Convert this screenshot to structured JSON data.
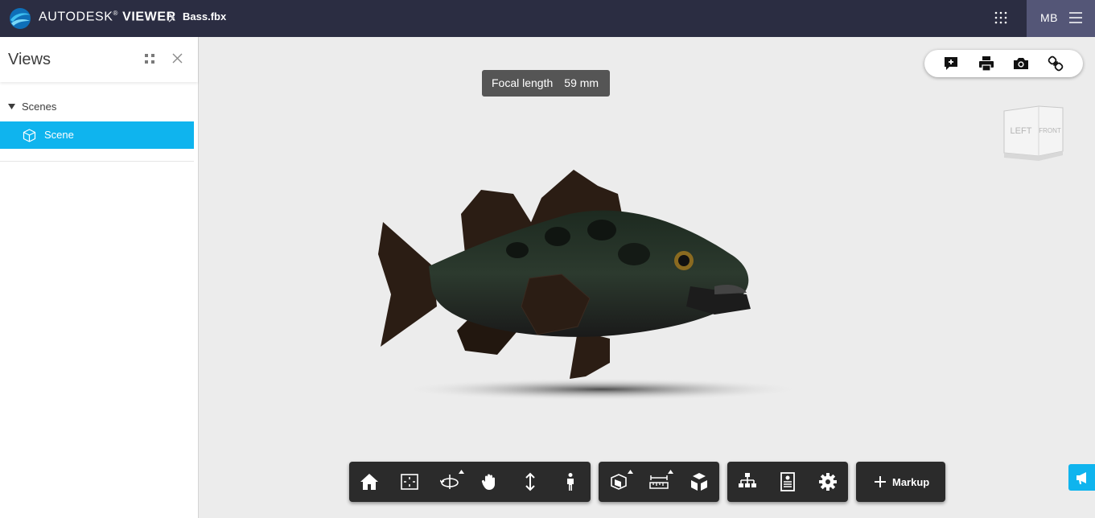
{
  "header": {
    "brand_primary": "AUTODESK",
    "brand_reg": "®",
    "brand_secondary": "VIEWER",
    "filename": "Bass.fbx",
    "user_initials": "MB",
    "background": "#2b2d42",
    "user_background": "#545677"
  },
  "panel": {
    "title": "Views",
    "group_label": "Scenes",
    "items": [
      {
        "label": "Scene",
        "selected": true,
        "icon": "cube-icon"
      }
    ],
    "selected_color": "#0fb4ee"
  },
  "viewport": {
    "tooltip_label": "Focal length",
    "tooltip_value": "59 mm",
    "top_tools": [
      "comment-icon",
      "print-icon",
      "camera-icon",
      "link-icon"
    ],
    "viewcube_faces": [
      "LEFT",
      "FRONT"
    ],
    "model": "bass-fish-3d-model"
  },
  "toolbar": {
    "navigation": [
      "home-icon",
      "fit-to-view-icon",
      "orbit-icon",
      "pan-icon",
      "dolly-icon",
      "first-person-icon"
    ],
    "modeling": [
      "section-analysis-icon",
      "measure-icon",
      "explode-model-icon"
    ],
    "settings": [
      "model-browser-icon",
      "properties-icon",
      "settings-gear-icon"
    ],
    "markup_label": "Markup"
  },
  "feedback": {
    "icon": "megaphone-icon",
    "color": "#0fb4ee"
  }
}
